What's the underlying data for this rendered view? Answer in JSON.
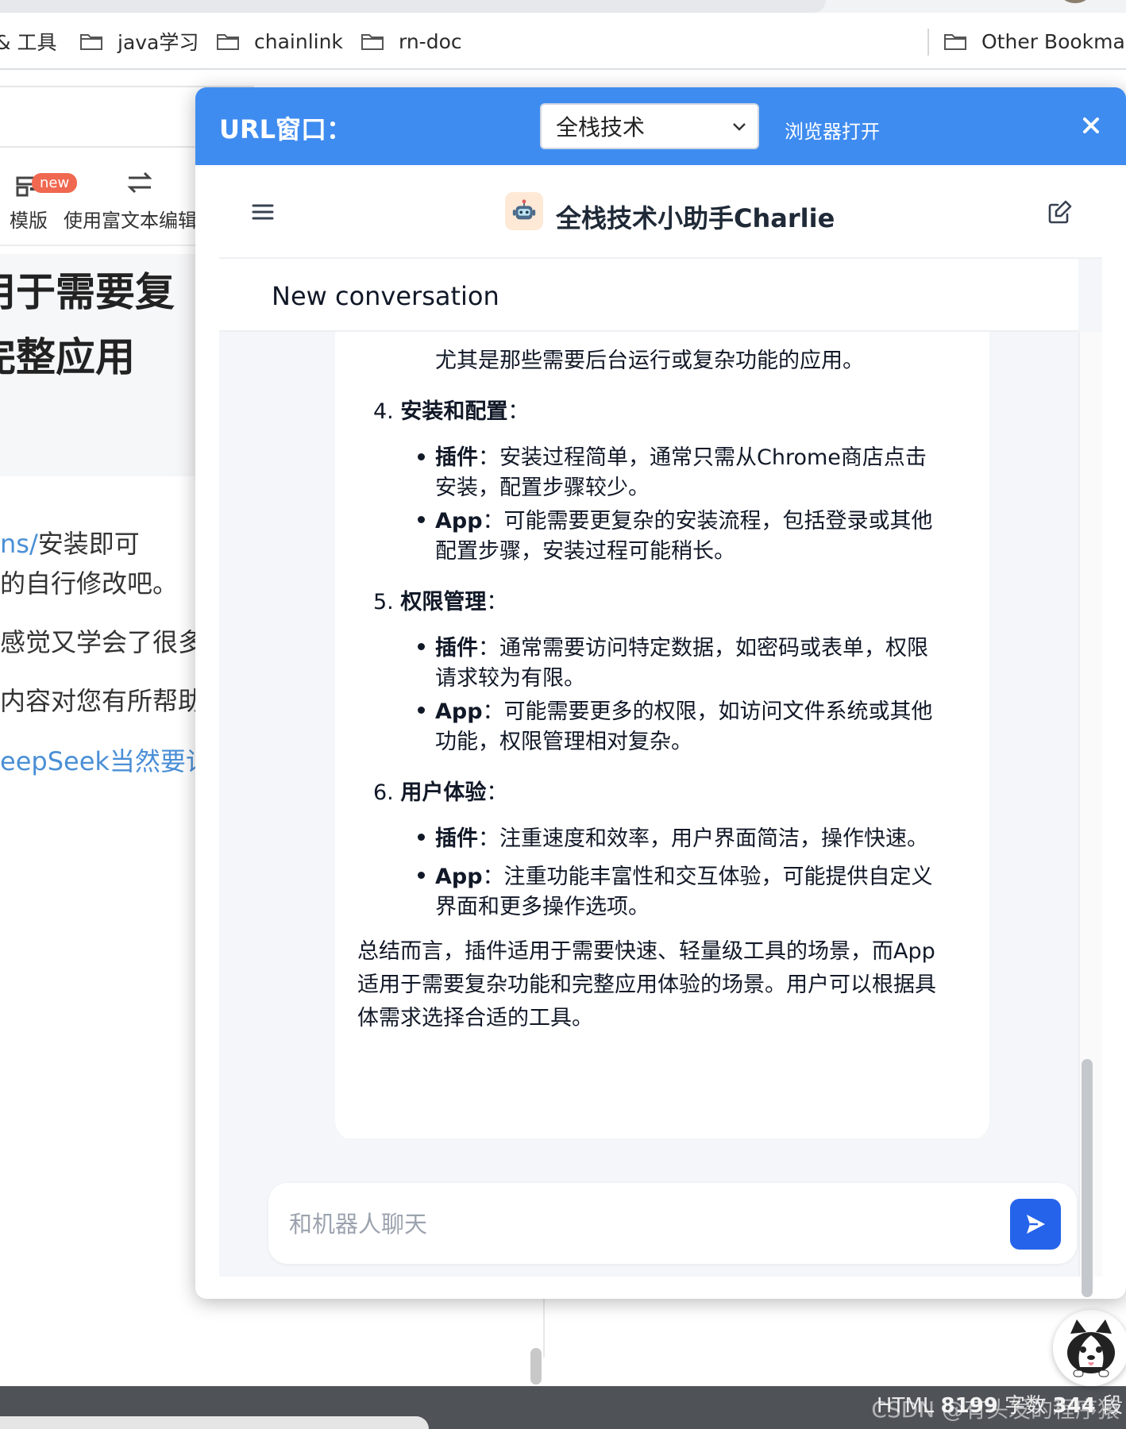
{
  "bookmarks": {
    "items": [
      {
        "label": "& 工具"
      },
      {
        "label": "java学习"
      },
      {
        "label": "chainlink"
      },
      {
        "label": "rn-doc"
      }
    ],
    "other": "Other Bookmarks"
  },
  "background_page": {
    "toolbar": {
      "badge": "new",
      "template_label": "模版",
      "rich_text_label": "使用富文本编辑器"
    },
    "title_lines": [
      "用于需要复",
      "完整应用"
    ],
    "text_lines": [
      {
        "link": "ns/",
        "text": "安装即可"
      },
      {
        "text": "的自行修改吧。"
      },
      {
        "text": "感觉又学会了很多"
      },
      {
        "text": "内容对您有所帮助"
      },
      {
        "link": "eepSeek当然要记住",
        "text": ""
      }
    ],
    "status": {
      "label_html": "HTML",
      "count": "8199",
      "chars": "字数",
      "para": "344",
      "para_label": "段"
    },
    "watermark": "CSDN @有头发的程序猿"
  },
  "popup": {
    "title": "URL窗口：",
    "select_value": "全栈技术",
    "open_browser": "浏览器打开",
    "chat": {
      "bot_name": "全栈技术小助手Charlie",
      "conversation_title": "New conversation",
      "input_placeholder": "和机器人聊天",
      "message": {
        "partial_line": "尤其是那些需要后台运行或复杂功能的应用。",
        "sections": [
          {
            "number": "4.",
            "heading": "安装和配置",
            "items": [
              {
                "label": "插件",
                "lines": [
                  "：安装过程简单，通常只需从Chrome商店点击",
                  "安装，配置步骤较少。"
                ]
              },
              {
                "label": "App",
                "lines": [
                  "：可能需要更复杂的安装流程，包括登录或其他",
                  "配置步骤，安装过程可能稍长。"
                ]
              }
            ]
          },
          {
            "number": "5.",
            "heading": "权限管理",
            "items": [
              {
                "label": "插件",
                "lines": [
                  "：通常需要访问特定数据，如密码或表单，权限",
                  "请求较为有限。"
                ]
              },
              {
                "label": "App",
                "lines": [
                  "：可能需要更多的权限，如访问文件系统或其他",
                  "功能，权限管理相对复杂。"
                ]
              }
            ]
          },
          {
            "number": "6.",
            "heading": "用户体验",
            "items": [
              {
                "label": "插件",
                "lines": [
                  "：注重速度和效率，用户界面简洁，操作快速。"
                ]
              },
              {
                "label": "App",
                "lines": [
                  "：注重功能丰富性和交互体验，可能提供自定义",
                  "界面和更多操作选项。"
                ]
              }
            ]
          }
        ],
        "summary": [
          "总结而言，插件适用于需要快速、轻量级工具的场景，而App",
          "适用于需要复杂功能和完整应用体验的场景。用户可以根据具",
          "体需求选择合适的工具。"
        ]
      }
    }
  },
  "colors": {
    "header_blue": "#3f8cf0",
    "send_blue": "#2563eb"
  }
}
